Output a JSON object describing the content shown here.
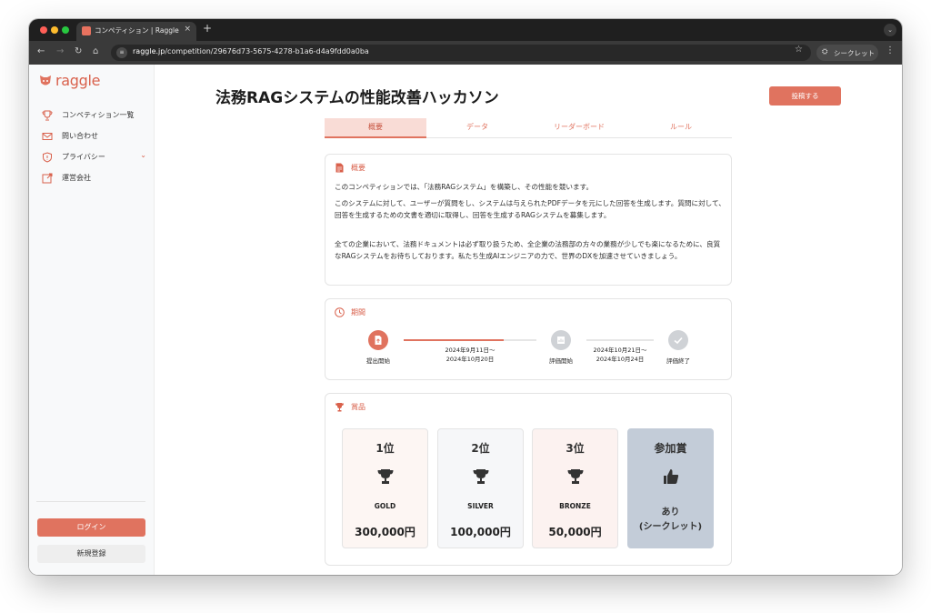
{
  "browser": {
    "tab_title": "コンペティション | Raggle",
    "tab_close": "×",
    "new_tab": "+",
    "url_host": "raggle.jp",
    "url_path": "/competition/29676d73-5675-4278-b1a6-d4a9fdd0a0ba",
    "incognito_label": "シークレット"
  },
  "sidebar": {
    "logo": "raggle",
    "items": [
      {
        "label": "コンペティション一覧",
        "icon": "trophy-icon"
      },
      {
        "label": "問い合わせ",
        "icon": "mail-icon"
      },
      {
        "label": "プライバシー",
        "icon": "shield-icon"
      },
      {
        "label": "運営会社",
        "icon": "external-link-icon"
      }
    ],
    "login": "ログイン",
    "signup": "新規登録"
  },
  "main": {
    "title": "法務RAGシステムの性能改善ハッカソン",
    "submit": "投稿する",
    "tabs": [
      {
        "label": "概要",
        "active": true
      },
      {
        "label": "データ",
        "active": false
      },
      {
        "label": "リーダーボード",
        "active": false
      },
      {
        "label": "ルール",
        "active": false
      }
    ],
    "overview": {
      "heading": "概要",
      "p1": "このコンペティションでは、「法務RAGシステム」を構築し、その性能を競います。",
      "p2": "このシステムに対して、ユーザーが質問をし、システムは与えられたPDFデータを元にした回答を生成します。質問に対して、回答を生成するための文書を適切に取得し、回答を生成するRAGシステムを募集します。",
      "p3": "全ての企業において、法務ドキュメントは必ず取り扱うため、全企業の法務部の方々の業務が少しでも楽になるために、良質なRAGシステムをお待ちしております。私たち生成AIエンジニアの力で、世界のDXを加速させていきましょう。"
    },
    "period": {
      "heading": "期間",
      "step1": "提出開始",
      "range1_a": "2024年9月11日〜",
      "range1_b": "2024年10月20日",
      "step2": "評価開始",
      "range2_a": "2024年10月21日〜",
      "range2_b": "2024年10月24日",
      "step3": "評価終了",
      "progress": 0.75
    },
    "prizes": {
      "heading": "賞品",
      "items": [
        {
          "rank": "1位",
          "tier": "GOLD",
          "amount": "300,000円",
          "bg": "#fdf6f3"
        },
        {
          "rank": "2位",
          "tier": "SILVER",
          "amount": "100,000円",
          "bg": "#f6f7f9"
        },
        {
          "rank": "3位",
          "tier": "BRONZE",
          "amount": "50,000円",
          "bg": "#fcf2f0"
        }
      ],
      "participation": {
        "rank": "参加賞",
        "line1": "あり",
        "line2": "(シークレット)",
        "bg": "#c3ccd8"
      }
    }
  },
  "colors": {
    "accent": "#e0735f",
    "accent_text": "#d9614c"
  }
}
